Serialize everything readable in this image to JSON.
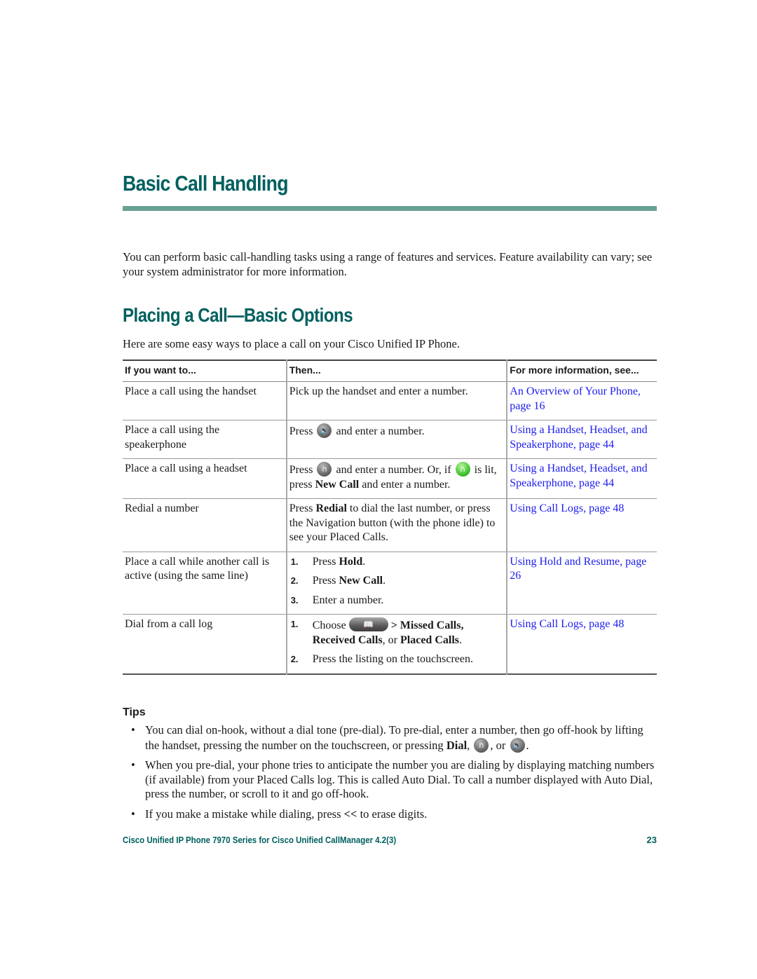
{
  "chapter": {
    "title": "Basic Call Handling",
    "accent_color": "#00605f",
    "rule_color": "#66a293",
    "intro": "You can perform basic call-handling tasks using a range of features and services. Feature availability can vary; see your system administrator for more information."
  },
  "section": {
    "title": "Placing a Call—Basic Options",
    "lead": "Here are some easy ways to place a call on your Cisco Unified IP Phone."
  },
  "table": {
    "headers": [
      "If you want to...",
      "Then...",
      "For more information, see..."
    ],
    "rows": [
      {
        "want": "Place a call using the handset",
        "then": "Pick up the handset and enter a number.",
        "see": "An Overview of Your Phone, page 16"
      },
      {
        "want": "Place a call using the speakerphone",
        "then_pre": "Press",
        "then_icon": "speaker-icon",
        "then_post": "and enter a number.",
        "see": "Using a Handset, Headset, and Speakerphone, page 44"
      },
      {
        "want": "Place a call using a headset",
        "then_pre": "Press",
        "then_icon": "headset-icon",
        "then_mid": "and enter a number. Or, if",
        "then_icon2": "headset-lit-icon",
        "then_mid2": "is lit, press",
        "then_bold": "New Call",
        "then_post": "and enter a number.",
        "see": "Using a Handset, Headset, and Speakerphone, page 44"
      },
      {
        "want": "Redial a number",
        "then_pre": "Press",
        "then_bold": "Redial",
        "then_post": "to dial the last number, or press the Navigation button (with the phone idle) to see your Placed Calls.",
        "see": "Using Call Logs, page 48"
      },
      {
        "want": "Place a call while another call is active (using the same line)",
        "steps": [
          {
            "num": "1.",
            "pre": "Press",
            "bold": "Hold",
            "post": "."
          },
          {
            "num": "2.",
            "pre": "Press",
            "bold": "New Call",
            "post": "."
          },
          {
            "num": "3.",
            "pre": "Enter a number.",
            "bold": "",
            "post": ""
          }
        ],
        "see": "Using Hold and Resume, page 26"
      },
      {
        "want": "Dial from a call log",
        "steps": [
          {
            "num": "1.",
            "pre": "Choose",
            "icon": "directories-button-icon",
            "bold": "> Missed Calls, Received Calls",
            "mid": ", or",
            "bold2": "Placed Calls",
            "post": "."
          },
          {
            "num": "2.",
            "pre": "Press the listing on the touchscreen.",
            "bold": "",
            "post": ""
          }
        ],
        "see": "Using Call Logs, page 48"
      }
    ],
    "link_color": "#1c1cf0"
  },
  "tips": {
    "heading": "Tips",
    "items": [
      {
        "pre": "You can dial on-hook, without a dial tone (pre-dial). To pre-dial, enter a number, then go off-hook by lifting the handset, pressing the number on the touchscreen, or pressing",
        "bold": "Dial",
        "sep1": ",",
        "icon1": "headset-icon",
        "sep2": ", or",
        "icon2": "speaker-icon",
        "post": "."
      },
      {
        "text": "When you pre-dial, your phone tries to anticipate the number you are dialing by displaying matching numbers (if available) from your Placed Calls log. This is called Auto Dial. To call a number displayed with Auto Dial, press the number, or scroll to it and go off-hook."
      },
      {
        "pre": "If you make a mistake while dialing, press",
        "bold": "<<",
        "post": "to erase digits."
      }
    ],
    "bullet": "•"
  },
  "footer": {
    "title": "Cisco Unified IP Phone 7970 Series for Cisco Unified CallManager 4.2(3)",
    "page_number": "23"
  }
}
